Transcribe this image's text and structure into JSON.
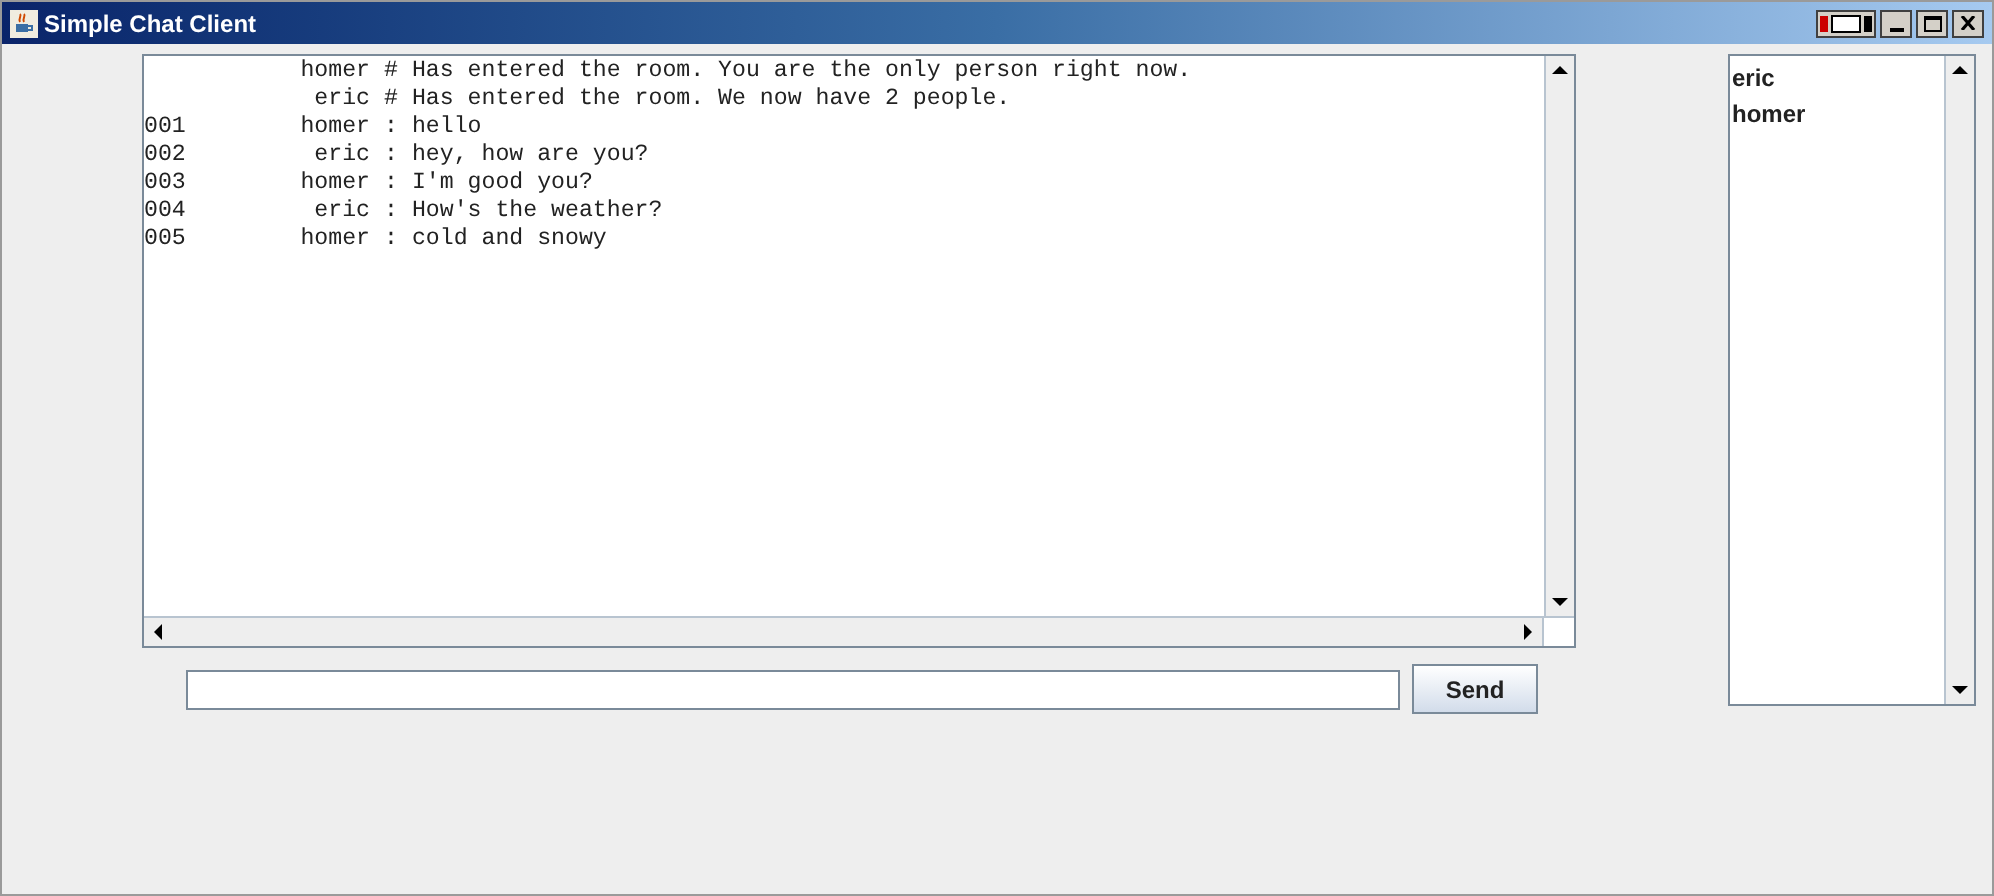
{
  "window": {
    "title": "Simple Chat Client"
  },
  "chat_lines": [
    {
      "sender": "homer",
      "separator": "#",
      "message": "Has entered the room. You are the only person right now."
    },
    {
      "sender": "eric",
      "separator": "#",
      "message": "Has entered the room. We now have 2 people."
    },
    {
      "number": "001",
      "sender": "homer",
      "separator": ":",
      "message": "hello"
    },
    {
      "number": "002",
      "sender": "eric",
      "separator": ":",
      "message": "hey, how are you?"
    },
    {
      "number": "003",
      "sender": "homer",
      "separator": ":",
      "message": "I'm good you?"
    },
    {
      "number": "004",
      "sender": "eric",
      "separator": ":",
      "message": "How's the weather?"
    },
    {
      "number": "005",
      "sender": "homer",
      "separator": ":",
      "message": "cold and snowy"
    }
  ],
  "send_button": "Send",
  "users": [
    "eric",
    "homer"
  ]
}
